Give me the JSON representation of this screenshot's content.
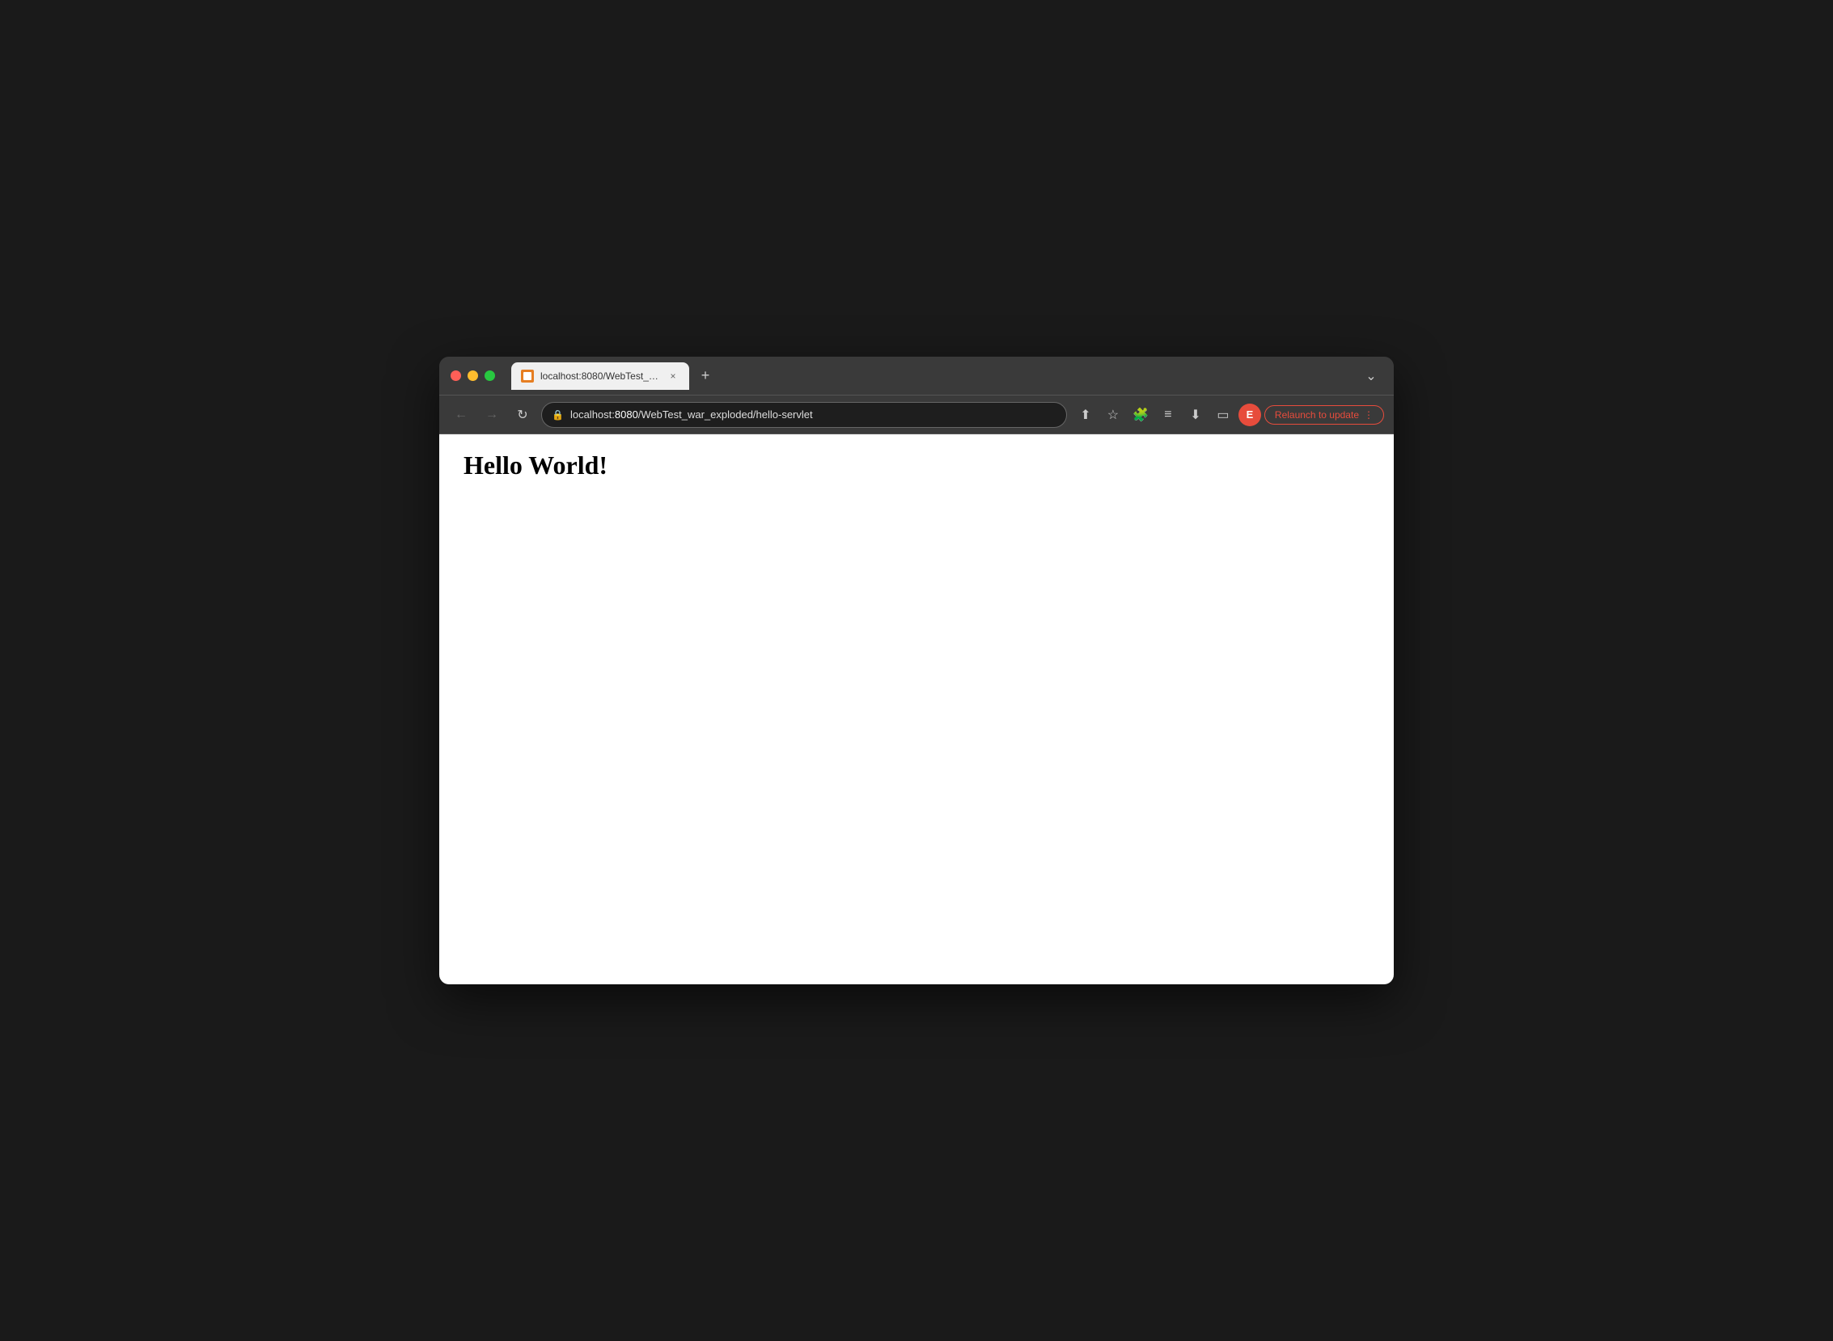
{
  "browser": {
    "window_controls": {
      "close_label": "",
      "minimize_label": "",
      "maximize_label": ""
    },
    "tab": {
      "title": "localhost:8080/WebTest_war...",
      "close_label": "×",
      "favicon_alt": "page-favicon"
    },
    "new_tab_label": "+",
    "tab_dropdown_label": "⌄",
    "nav": {
      "back_label": "←",
      "forward_label": "→",
      "reload_label": "↻",
      "address": {
        "protocol": "localhost:",
        "host": "8080",
        "path": "/WebTest_war_exploded/hello-servlet",
        "full": "localhost:8080/WebTest_war_exploded/hello-servlet",
        "lock_symbol": "🔒"
      },
      "share_label": "⬆",
      "bookmark_label": "☆",
      "extensions_label": "🧩",
      "reading_list_label": "≡",
      "download_label": "⬇",
      "sidebar_label": "▭",
      "profile_label": "E",
      "relaunch_label": "Relaunch to update",
      "more_label": "⋮"
    }
  },
  "page": {
    "heading": "Hello World!"
  }
}
